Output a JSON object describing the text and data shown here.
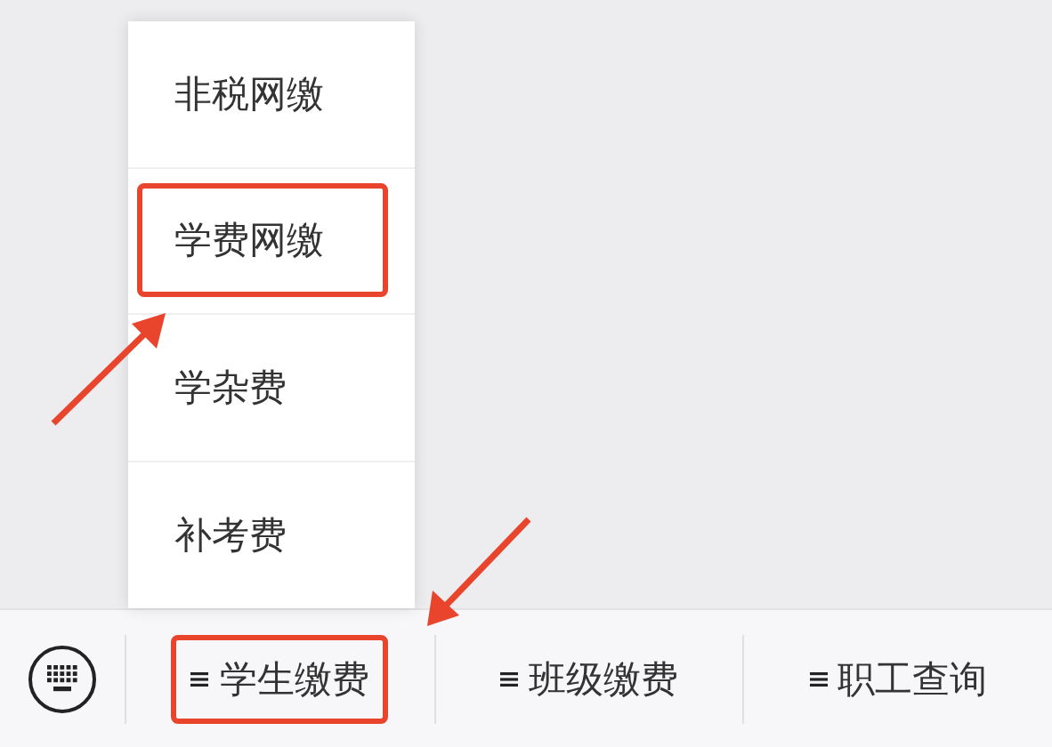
{
  "popup_menu": {
    "items": [
      {
        "label": "非税网缴",
        "highlighted": false
      },
      {
        "label": "学费网缴",
        "highlighted": true
      },
      {
        "label": "学杂费",
        "highlighted": false
      },
      {
        "label": "补考费",
        "highlighted": false
      }
    ]
  },
  "bottom_menu": {
    "items": [
      {
        "label": "学生缴费",
        "highlighted": true
      },
      {
        "label": "班级缴费",
        "highlighted": false
      },
      {
        "label": "职工查询",
        "highlighted": false
      }
    ]
  }
}
